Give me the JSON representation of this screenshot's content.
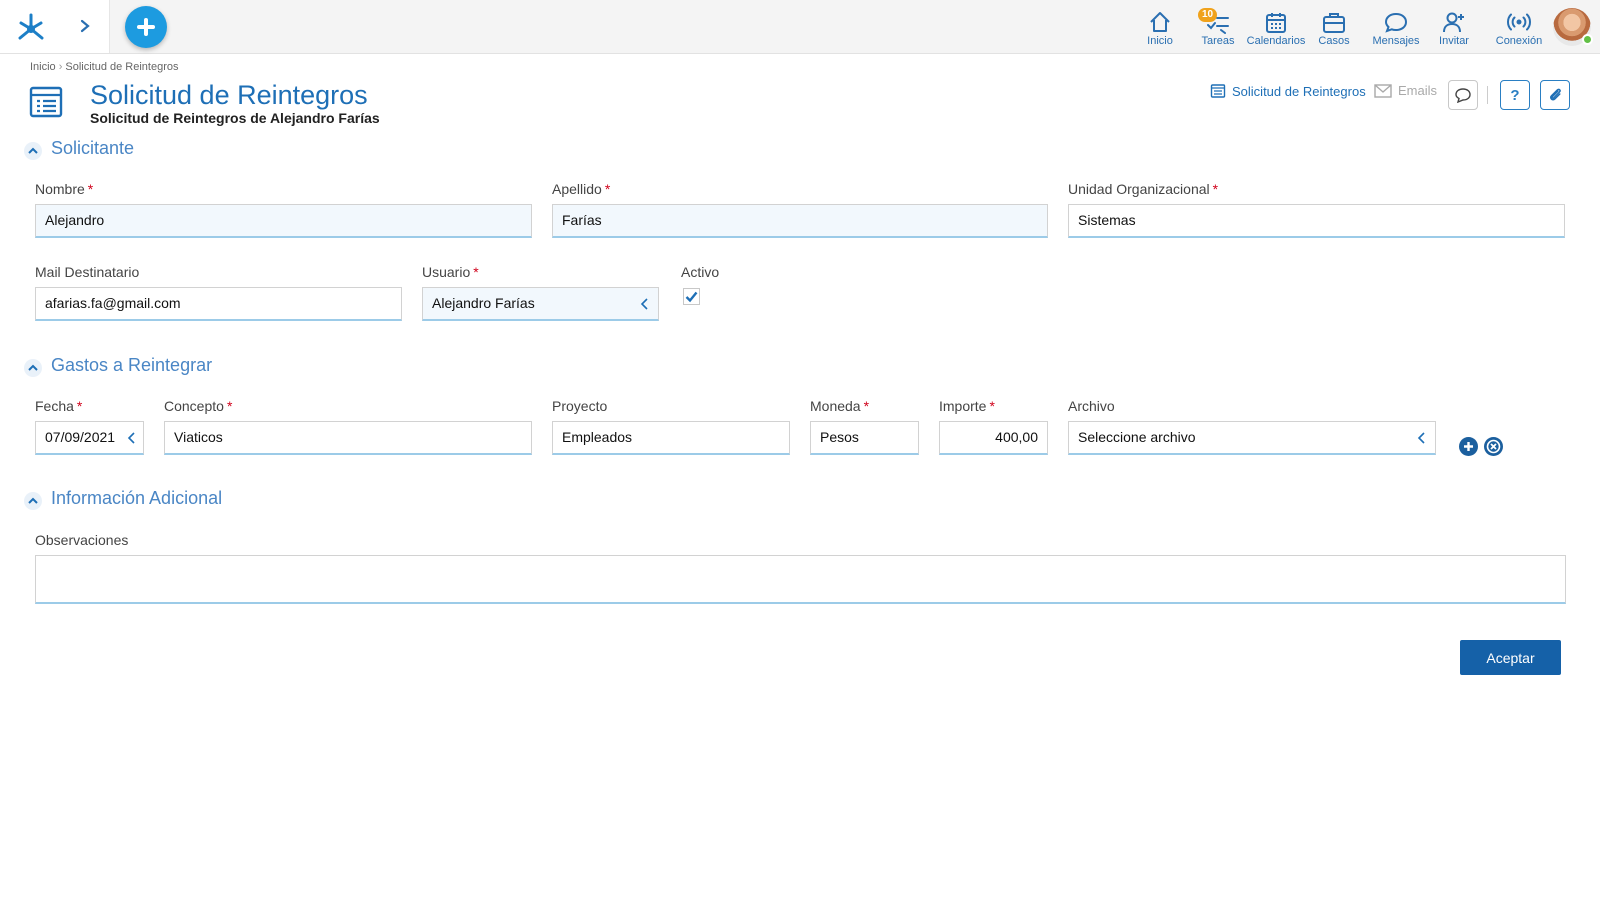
{
  "nav": {
    "items": [
      {
        "label": "Inicio",
        "icon": "home-icon"
      },
      {
        "label": "Tareas",
        "icon": "tasks-icon",
        "badge": "10"
      },
      {
        "label": "Calendarios",
        "icon": "calendar-icon"
      },
      {
        "label": "Casos",
        "icon": "briefcase-icon"
      },
      {
        "label": "Mensajes",
        "icon": "chat-icon"
      },
      {
        "label": "Invitar",
        "icon": "invite-icon"
      },
      {
        "label": "Conexión",
        "icon": "signal-icon"
      }
    ]
  },
  "breadcrumb": {
    "home": "Inicio",
    "separator": "›",
    "current": "Solicitud de Reintegros"
  },
  "header": {
    "title": "Solicitud de Reintegros",
    "subtitle": "Solicitud de Reintegros de Alejandro Farías",
    "form_link": "Solicitud de Reintegros",
    "emails_link": "Emails",
    "help_label": "?"
  },
  "sections": {
    "solicitante": {
      "title": "Solicitante",
      "nombre_label": "Nombre",
      "nombre_value": "Alejandro",
      "apellido_label": "Apellido",
      "apellido_value": "Farías",
      "unidad_label": "Unidad Organizacional",
      "unidad_value": "Sistemas",
      "mail_label": "Mail Destinatario",
      "mail_value": "afarias.fa@gmail.com",
      "usuario_label": "Usuario",
      "usuario_value": "Alejandro Farías",
      "activo_label": "Activo",
      "activo_checked": true
    },
    "gastos": {
      "title": "Gastos a Reintegrar",
      "fecha_label": "Fecha",
      "fecha_value": "07/09/2021",
      "concepto_label": "Concepto",
      "concepto_value": "Viaticos",
      "proyecto_label": "Proyecto",
      "proyecto_value": "Empleados",
      "moneda_label": "Moneda",
      "moneda_value": "Pesos",
      "importe_label": "Importe",
      "importe_value": "400,00",
      "archivo_label": "Archivo",
      "archivo_value": "Seleccione archivo"
    },
    "adicional": {
      "title": "Información Adicional",
      "observaciones_label": "Observaciones",
      "observaciones_value": ""
    }
  },
  "required_mark": "*",
  "actions": {
    "accept_label": "Aceptar"
  },
  "colors": {
    "accent": "#1e6fb6",
    "fab": "#1d9be0",
    "button": "#1561a8",
    "badge": "#f0a21b",
    "required": "#d0021b"
  }
}
